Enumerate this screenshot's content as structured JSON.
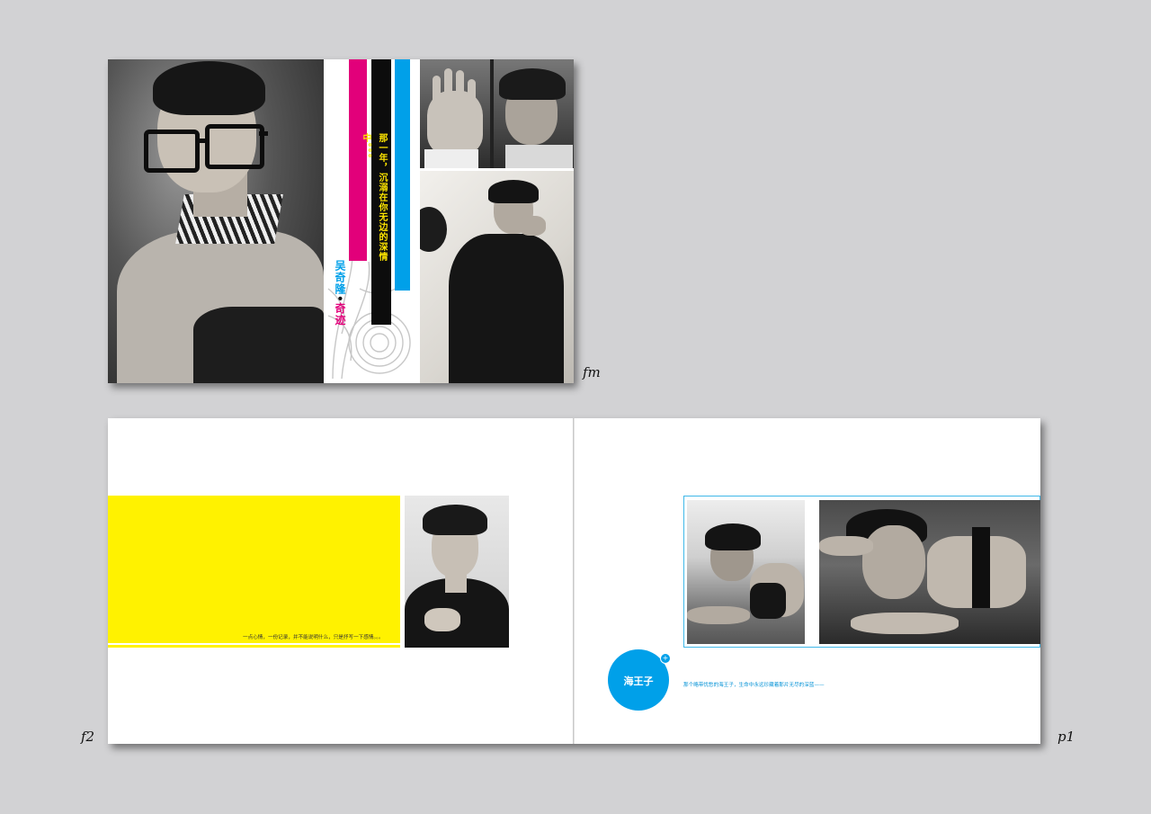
{
  "cover": {
    "vertical_quote": "那一年，沉溺在你无边的深情中。。。",
    "title_name": "吴奇隆",
    "title_dot": "•",
    "title_word": "奇迹",
    "colors": {
      "magenta": "#e2007a",
      "black": "#0c0c0c",
      "cyan": "#00a0e9",
      "quote": "#ffe600"
    }
  },
  "labels": {
    "cover": "fm",
    "left_page": "f2",
    "right_page": "p1"
  },
  "left_page": {
    "caption": "一点心情，一份记录，并不能说明什么，只是抒写一下感情。。。",
    "colors": {
      "yellow": "#fff200"
    }
  },
  "right_page": {
    "circle_title": "海王子",
    "circle_plus": "+",
    "caption": "那个略带忧愁的海王子，生命中永远珍藏着那片无尽的深蓝——",
    "colors": {
      "cyan": "#00a0e9",
      "frame": "#3fb8e8"
    }
  }
}
